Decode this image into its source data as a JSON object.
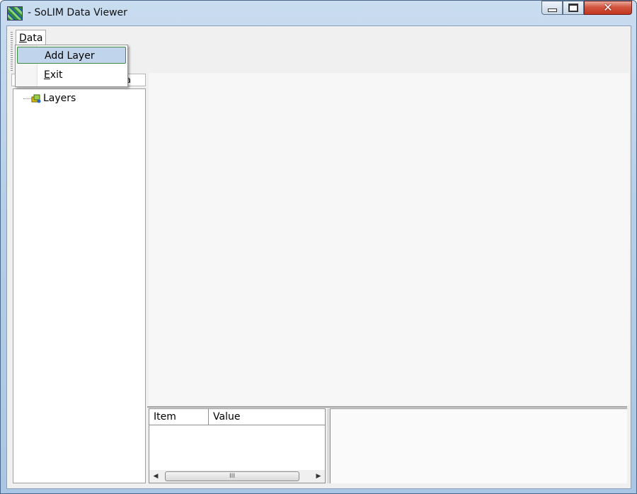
{
  "window": {
    "title": "- SoLIM Data Viewer",
    "controls": {
      "close_glyph": "✕"
    }
  },
  "menubar": {
    "data_menu": {
      "label_accel": "D",
      "label_rest": "ata",
      "items": [
        {
          "label": "Add Layer"
        },
        {
          "label_accel": "E",
          "label_rest": "xit"
        }
      ]
    }
  },
  "tree": {
    "root": {
      "label": "Layers",
      "icon": "layers-icon"
    },
    "header_fragment": "a"
  },
  "grid": {
    "columns": [
      "Item",
      "Value"
    ],
    "scroll_grip": "III"
  },
  "colors": {
    "menu_highlight": "#c0d4ec",
    "menu_highlight_border": "#3c8a3c",
    "close_button": "#c2361f"
  }
}
